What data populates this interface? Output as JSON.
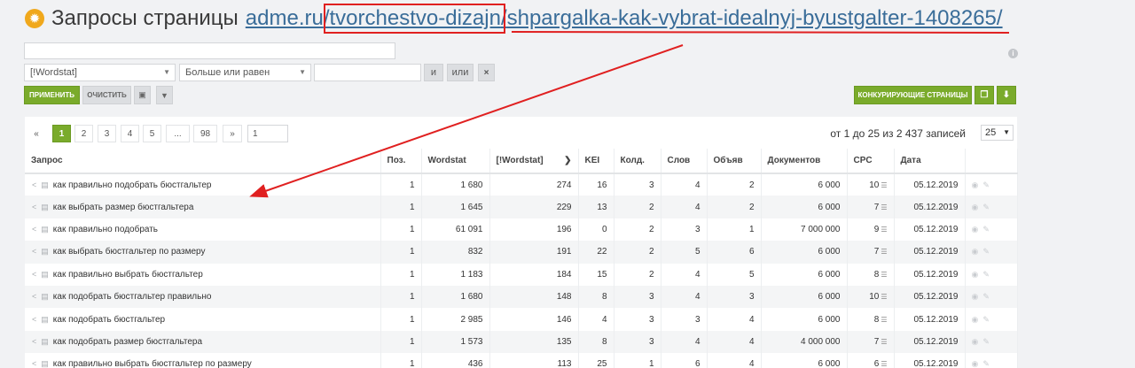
{
  "header": {
    "title": "Запросы страницы",
    "url_domain": "adme.ru",
    "url_sep1": "/",
    "url_section": "tvorchestvo-dizajn",
    "url_sep2": "/",
    "url_page": "shpargalka-kak-vybrat-idealnyj-byustgalter-1408265/",
    "url_end": "/"
  },
  "filter": {
    "text_value": "",
    "field_select": "[!Wordstat]",
    "operator_select": "Больше или равен",
    "value": "",
    "and_label": "и",
    "or_label": "или",
    "remove_label": "×",
    "apply_label": "ПРИМЕНИТЬ",
    "clear_label": "ОЧИСТИТЬ"
  },
  "actions": {
    "competitors_label": "КОНКУРИРУЮЩИЕ СТРАНИЦЫ"
  },
  "pagination": {
    "prev": "«",
    "pages": [
      "1",
      "2",
      "3",
      "4",
      "5",
      "...",
      "98"
    ],
    "next": "»",
    "jump_value": "1",
    "records": "от 1 до 25 из 2 437 записей",
    "per_page": "25"
  },
  "table": {
    "columns": [
      "Запрос",
      "Поз.",
      "Wordstat",
      "[!Wordstat]",
      "KEI",
      "Колд.",
      "Слов",
      "Объяв",
      "Документов",
      "CPC",
      "Дата"
    ],
    "rows": [
      [
        "как правильно подобрать бюстгальтер",
        "1",
        "1 680",
        "274",
        "16",
        "3",
        "4",
        "2",
        "6 000",
        "10",
        "05.12.2019"
      ],
      [
        "как выбрать размер бюстгальтера",
        "1",
        "1 645",
        "229",
        "13",
        "2",
        "4",
        "2",
        "6 000",
        "7",
        "05.12.2019"
      ],
      [
        "как правильно подобрать",
        "1",
        "61 091",
        "196",
        "0",
        "2",
        "3",
        "1",
        "7 000 000",
        "9",
        "05.12.2019"
      ],
      [
        "как выбрать бюстгальтер по размеру",
        "1",
        "832",
        "191",
        "22",
        "2",
        "5",
        "6",
        "6 000",
        "7",
        "05.12.2019"
      ],
      [
        "как правильно выбрать бюстгальтер",
        "1",
        "1 183",
        "184",
        "15",
        "2",
        "4",
        "5",
        "6 000",
        "8",
        "05.12.2019"
      ],
      [
        "как подобрать бюстгальтер правильно",
        "1",
        "1 680",
        "148",
        "8",
        "3",
        "4",
        "3",
        "6 000",
        "10",
        "05.12.2019"
      ],
      [
        "как подобрать бюстгальтер",
        "1",
        "2 985",
        "146",
        "4",
        "3",
        "3",
        "4",
        "6 000",
        "8",
        "05.12.2019"
      ],
      [
        "как подобрать размер бюстгальтера",
        "1",
        "1 573",
        "135",
        "8",
        "3",
        "4",
        "4",
        "4 000 000",
        "7",
        "05.12.2019"
      ],
      [
        "как правильно выбрать бюстгальтер по размеру",
        "1",
        "436",
        "113",
        "25",
        "1",
        "6",
        "4",
        "6 000",
        "6",
        "05.12.2019"
      ]
    ]
  },
  "icons": {
    "gear": "gear-icon",
    "share": "share-icon",
    "doc": "document-icon",
    "info": "info-icon",
    "eye": "eye-icon",
    "pin": "pin-icon"
  },
  "colors": {
    "accent_green": "#7aab2b",
    "link_blue": "#3a6d99",
    "annotation_red": "#e02020"
  }
}
